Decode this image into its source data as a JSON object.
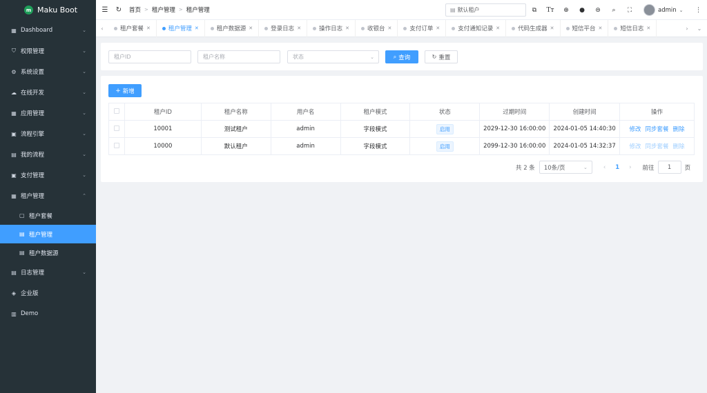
{
  "app": {
    "name": "Maku Boot",
    "logo_text": "m"
  },
  "sidebar": {
    "items": [
      {
        "label": "Dashboard",
        "icon": "dashboard-icon",
        "glyph": "▦"
      },
      {
        "label": "权限管理",
        "icon": "shield-icon",
        "glyph": "⛉"
      },
      {
        "label": "系统设置",
        "icon": "gear-icon",
        "glyph": "⚙"
      },
      {
        "label": "在线开发",
        "icon": "cloud-icon",
        "glyph": "☁"
      },
      {
        "label": "应用管理",
        "icon": "apps-icon",
        "glyph": "▦"
      },
      {
        "label": "流程引擎",
        "icon": "flow-icon",
        "glyph": "▣"
      },
      {
        "label": "我的流程",
        "icon": "document-icon",
        "glyph": "▤"
      },
      {
        "label": "支付管理",
        "icon": "payment-icon",
        "glyph": "▣"
      },
      {
        "label": "租户管理",
        "icon": "tenant-icon",
        "glyph": "▦"
      }
    ],
    "subitems": [
      {
        "label": "租户套餐",
        "icon": "package-icon",
        "glyph": "▢"
      },
      {
        "label": "租户管理",
        "icon": "tenant-list-icon",
        "glyph": "▤"
      },
      {
        "label": "租户数据源",
        "icon": "datasource-icon",
        "glyph": "▤"
      }
    ],
    "items_after": [
      {
        "label": "日志管理",
        "icon": "log-icon",
        "glyph": "▤"
      },
      {
        "label": "企业版",
        "icon": "diamond-icon",
        "glyph": "◈"
      },
      {
        "label": "Demo",
        "icon": "demo-icon",
        "glyph": "▥"
      }
    ]
  },
  "header": {
    "menu_glyph": "☰",
    "refresh_glyph": "↻",
    "breadcrumb": [
      "首页",
      "租户管理",
      "租户管理"
    ],
    "search_value": "默认租户",
    "user": "admin"
  },
  "tabs": [
    {
      "label": "租户套餐"
    },
    {
      "label": "租户管理"
    },
    {
      "label": "租户数据源"
    },
    {
      "label": "登录日志"
    },
    {
      "label": "操作日志"
    },
    {
      "label": "收银台"
    },
    {
      "label": "支付订单"
    },
    {
      "label": "支付通知记录"
    },
    {
      "label": "代码生成器"
    },
    {
      "label": "短信平台"
    },
    {
      "label": "短信日志"
    }
  ],
  "filters": {
    "tenant_id_placeholder": "租户ID",
    "tenant_name_placeholder": "租户名称",
    "status_placeholder": "状态",
    "query_label": "查询",
    "reset_label": "重置"
  },
  "toolbar": {
    "add_label": "新增"
  },
  "table": {
    "columns": [
      "租户ID",
      "租户名称",
      "用户名",
      "租户模式",
      "状态",
      "过期时间",
      "创建时间",
      "操作"
    ],
    "rows": [
      {
        "id": "10001",
        "name": "测试租户",
        "username": "admin",
        "mode": "字段模式",
        "status": "启用",
        "expire": "2029-12-30 16:00:00",
        "created": "2024-01-05 14:40:30",
        "actions": [
          "修改",
          "同步套餐",
          "删除"
        ]
      },
      {
        "id": "10000",
        "name": "默认租户",
        "username": "admin",
        "mode": "字段模式",
        "status": "启用",
        "expire": "2099-12-30 16:00:00",
        "created": "2024-01-05 14:32:37",
        "actions": [
          "修改",
          "同步套餐",
          "删除"
        ]
      }
    ]
  },
  "pagination": {
    "total": "共 2 条",
    "page_size": "10条/页",
    "current": "1",
    "goto_label": "前往",
    "goto_value": "1",
    "page_suffix": "页"
  },
  "colors": {
    "primary": "#409eff",
    "sidebar_bg": "#263238",
    "active_menu": "#409eff"
  }
}
